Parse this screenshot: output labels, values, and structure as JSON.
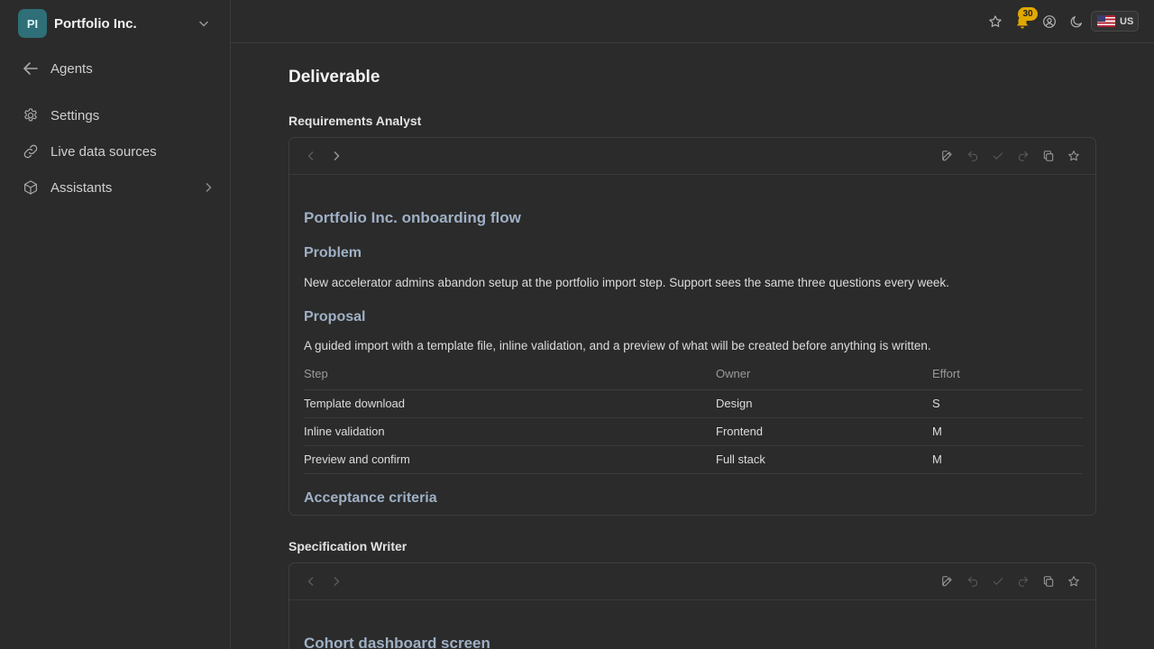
{
  "org": {
    "initials": "PI",
    "name": "Portfolio Inc."
  },
  "sidebar": {
    "items": [
      {
        "label": "Agents",
        "icon": "arrow-left-icon"
      },
      {
        "label": "Settings",
        "icon": "gear-icon"
      },
      {
        "label": "Live data sources",
        "icon": "link-icon"
      },
      {
        "label": "Assistants",
        "icon": "cube-icon"
      }
    ]
  },
  "topbar": {
    "notifications_count": "30",
    "locale": "US",
    "icons": [
      "star-icon",
      "bell-icon",
      "user-circle-icon",
      "moon-icon"
    ]
  },
  "main": {
    "title": "Deliverable",
    "sections": [
      {
        "title": "Requirements Analyst",
        "doc": {
          "heading": "Portfolio Inc. onboarding flow",
          "problem_heading": "Problem",
          "problem_text": "New accelerator admins abandon setup at the portfolio import step. Support sees the same three questions every week.",
          "proposal_heading": "Proposal",
          "proposal_text": "A guided import with a template file, inline validation, and a preview of what will be created before anything is written.",
          "table": {
            "headers": [
              "Step",
              "Owner",
              "Effort"
            ],
            "rows": [
              [
                "Template download",
                "Design",
                "S"
              ],
              [
                "Inline validation",
                "Frontend",
                "M"
              ],
              [
                "Preview and confirm",
                "Full stack",
                "M"
              ]
            ]
          },
          "criteria_heading": "Acceptance criteria"
        }
      },
      {
        "title": "Specification Writer",
        "doc": {
          "heading": "Cohort dashboard screen"
        }
      }
    ]
  },
  "colors": {
    "accent": "#2e6f78",
    "heading": "#9fb0c5",
    "badge": "#e0a800"
  }
}
